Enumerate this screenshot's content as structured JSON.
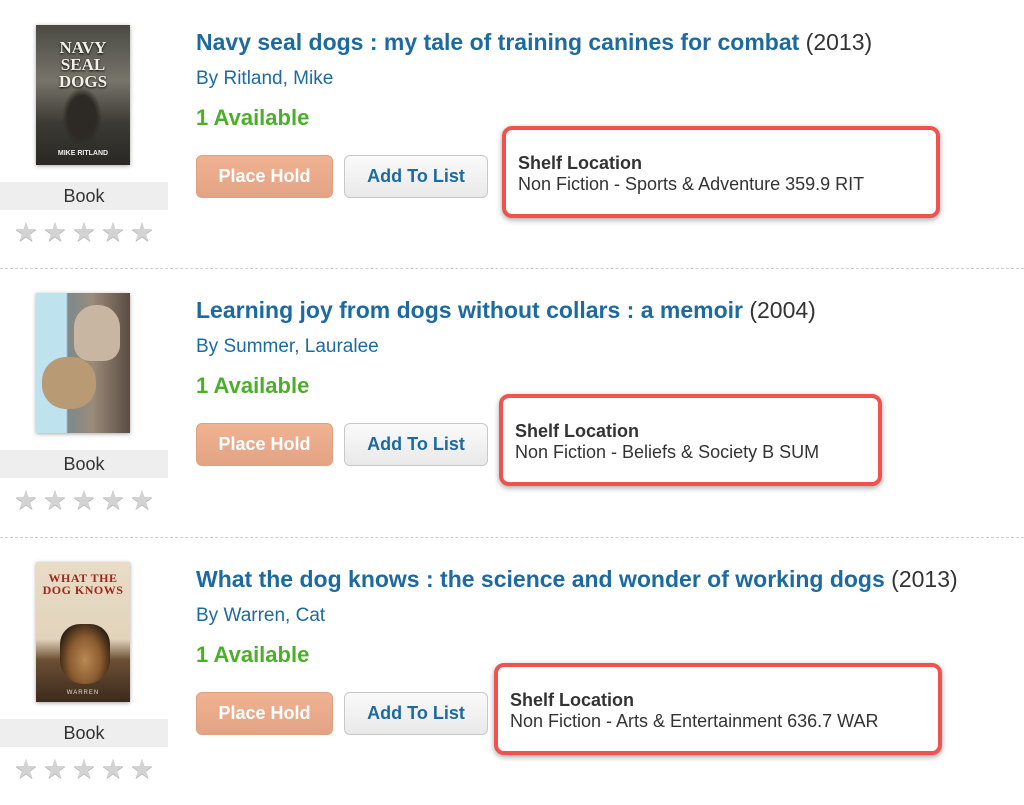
{
  "results": [
    {
      "cover": {
        "title": "NAVY SEAL DOGS",
        "author": "MIKE RITLAND"
      },
      "format": "Book",
      "title": "Navy seal dogs : my tale of training canines for combat",
      "year": "(2013)",
      "author_prefix": "By",
      "author": "Ritland, Mike",
      "availability": "1 Available",
      "hold_label": "Place Hold",
      "list_label": "Add To List",
      "shelf_label": "Shelf Location",
      "shelf_value": "Non Fiction - Sports & Adventure 359.9 RIT",
      "rating_stars": 0
    },
    {
      "cover": {
        "title": "",
        "author": ""
      },
      "format": "Book",
      "title": "Learning joy from dogs without collars : a memoir",
      "year": "(2004)",
      "author_prefix": "By",
      "author": "Summer, Lauralee",
      "availability": "1 Available",
      "hold_label": "Place Hold",
      "list_label": "Add To List",
      "shelf_label": "Shelf Location",
      "shelf_value": "Non Fiction - Beliefs & Society B SUM",
      "rating_stars": 0
    },
    {
      "cover": {
        "title": "WHAT THE DOG KNOWS",
        "author": "WARREN"
      },
      "format": "Book",
      "title": "What the dog knows : the science and wonder of working dogs",
      "year": "(2013)",
      "author_prefix": "By",
      "author": "Warren, Cat",
      "availability": "1 Available",
      "hold_label": "Place Hold",
      "list_label": "Add To List",
      "shelf_label": "Shelf Location",
      "shelf_value": "Non Fiction - Arts & Entertainment 636.7 WAR",
      "rating_stars": 0
    }
  ],
  "colors": {
    "link": "#1d6aa0",
    "available": "#4caf2a",
    "place_hold_bg": "#e8a98a",
    "highlight_border": "#f0524d",
    "star_empty": "#d3d3d3"
  },
  "icons": {
    "rating": "star-icon"
  }
}
